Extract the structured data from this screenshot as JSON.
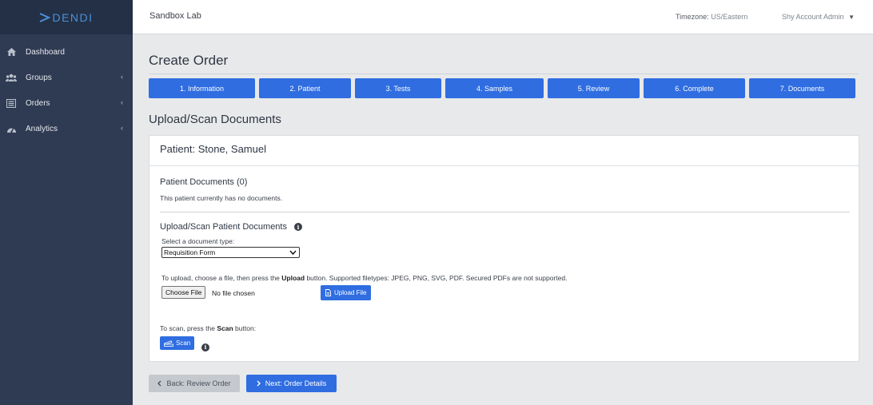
{
  "brand": {
    "name": "DENDI"
  },
  "sidebar": {
    "items": [
      {
        "label": "Dashboard",
        "icon": "home-icon",
        "has_chevron": false
      },
      {
        "label": "Groups",
        "icon": "users-icon",
        "has_chevron": true,
        "chevron": "‹"
      },
      {
        "label": "Orders",
        "icon": "list-icon",
        "has_chevron": true,
        "chevron": "‹"
      },
      {
        "label": "Analytics",
        "icon": "gauge-icon",
        "has_chevron": true,
        "chevron": "‹"
      }
    ]
  },
  "topbar": {
    "lab_name": "Sandbox Lab",
    "timezone_label": "Timezone:",
    "timezone_value": "US/Eastern",
    "user_name": "Shy Account Admin",
    "user_caret": "▼"
  },
  "page": {
    "title": "Create Order",
    "section_title": "Upload/Scan Documents"
  },
  "steps": [
    {
      "label": "1. Information"
    },
    {
      "label": "2. Patient"
    },
    {
      "label": "3. Tests"
    },
    {
      "label": "4. Samples"
    },
    {
      "label": "5. Review"
    },
    {
      "label": "6. Complete"
    },
    {
      "label": "7. Documents"
    }
  ],
  "card": {
    "patient_header": "Patient: Stone, Samuel",
    "docs_title": "Patient Documents (0)",
    "docs_empty": "This patient currently has no documents.",
    "upload_title": "Upload/Scan Patient Documents",
    "type_label": "Select a document type:",
    "type_selected": "Requisition Form",
    "upload_help_pre": "To upload, choose a file, then press the ",
    "upload_help_bold": "Upload",
    "upload_help_post": " button. Supported filetypes: JPEG, PNG, SVG, PDF. Secured PDFs are not supported.",
    "choose_file_label": "Choose File",
    "file_status": "No file chosen",
    "upload_button": "Upload File",
    "scan_help_pre": "To scan, press the ",
    "scan_help_bold": "Scan",
    "scan_help_post": " button:",
    "scan_button": "Scan"
  },
  "footer": {
    "back_label": "Back: Review Order",
    "next_label": "Next: Order Details"
  },
  "colors": {
    "sidebar_bg": "#2f3b52",
    "brand_bg": "#243046",
    "accent_blue": "#2f6de1",
    "page_bg": "#e8e9ea"
  }
}
